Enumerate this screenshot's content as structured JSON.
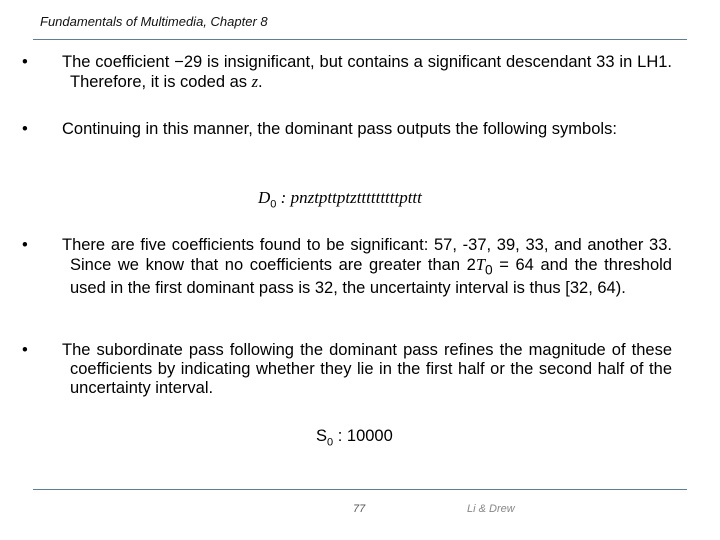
{
  "header": {
    "title": "Fundamentals of Multimedia, Chapter 8"
  },
  "bullets": [
    {
      "text_before": "The coefficient −29 is insignificant, but contains a significant descendant 33 in LH1. Therefore, it is coded as ",
      "italic": "z",
      "text_after": "."
    },
    {
      "text": "Continuing in this manner, the dominant pass outputs the following symbols:"
    },
    {
      "text_before": "There are five coefficients found to be significant: 57, -37, 39, 33, and another 33. Since we know that no coefficients are greater than 2",
      "italic": "T",
      "subscript": "0",
      "text_after": " = 64 and the threshold used in the first dominant pass is 32, the uncertainty interval is thus [32, 64)."
    },
    {
      "text": "The subordinate pass following the dominant pass refines the magnitude of these coefficients by indicating whether they lie in the first half or the second half of the uncertainty interval."
    }
  ],
  "formulas": {
    "dominant": {
      "symbol": "D",
      "subscript": "0",
      "separator": " : ",
      "value": "pnztpttptztttttttttpttt"
    },
    "subordinate": {
      "symbol": "S",
      "subscript": "0",
      "separator": " : ",
      "value": "10000"
    }
  },
  "footer": {
    "page_number": "77",
    "authors": "Li & Drew"
  },
  "colors": {
    "rule": "#5f7f8f"
  }
}
